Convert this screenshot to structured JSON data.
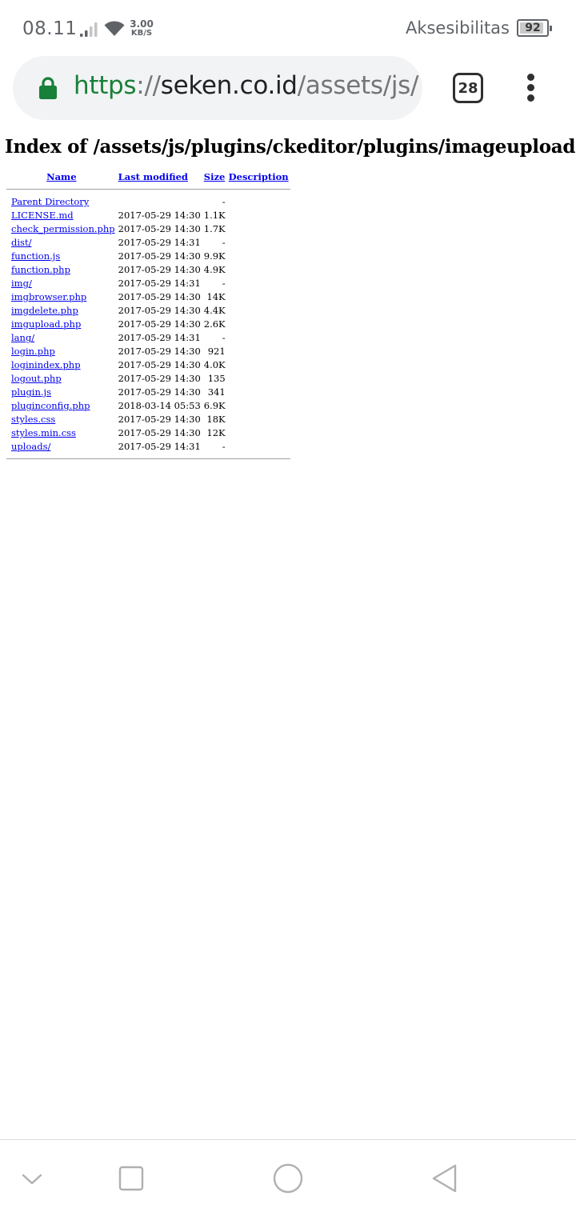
{
  "status_bar": {
    "time": "08.11",
    "speed_value": "3.00",
    "speed_unit": "KB/S",
    "accessibility_label": "Aksesibilitas",
    "battery_level": "92",
    "battery_fraction": 0.92
  },
  "browser": {
    "url": {
      "scheme": "https",
      "separator": "://",
      "host": "seken.co.id",
      "path": "/assets/js/"
    },
    "tab_count": "28",
    "colors": {
      "secure_scheme": "#188038",
      "lock": "#188038",
      "omnibox": "#f1f3f4",
      "link": "#0000ee"
    },
    "icons": {
      "lock": "lock-icon",
      "menu": "more-vert-icon"
    }
  },
  "page": {
    "title": "Index of /assets/js/plugins/ckeditor/plugins/imageuploader",
    "columns": {
      "name": "Name",
      "last_modified": "Last modified",
      "size": "Size",
      "description": "Description"
    },
    "entries": [
      {
        "name": "Parent Directory",
        "modified": "",
        "size": "-"
      },
      {
        "name": "LICENSE.md",
        "modified": "2017-05-29 14:30",
        "size": "1.1K"
      },
      {
        "name": "check_permission.php",
        "modified": "2017-05-29 14:30",
        "size": "1.7K"
      },
      {
        "name": "dist/",
        "modified": "2017-05-29 14:31",
        "size": "-"
      },
      {
        "name": "function.js",
        "modified": "2017-05-29 14:30",
        "size": "9.9K"
      },
      {
        "name": "function.php",
        "modified": "2017-05-29 14:30",
        "size": "4.9K"
      },
      {
        "name": "img/",
        "modified": "2017-05-29 14:31",
        "size": "-"
      },
      {
        "name": "imgbrowser.php",
        "modified": "2017-05-29 14:30",
        "size": "14K"
      },
      {
        "name": "imgdelete.php",
        "modified": "2017-05-29 14:30",
        "size": "4.4K"
      },
      {
        "name": "imgupload.php",
        "modified": "2017-05-29 14:30",
        "size": "2.6K"
      },
      {
        "name": "lang/",
        "modified": "2017-05-29 14:31",
        "size": "-"
      },
      {
        "name": "login.php",
        "modified": "2017-05-29 14:30",
        "size": "921"
      },
      {
        "name": "loginindex.php",
        "modified": "2017-05-29 14:30",
        "size": "4.0K"
      },
      {
        "name": "logout.php",
        "modified": "2017-05-29 14:30",
        "size": "135"
      },
      {
        "name": "plugin.js",
        "modified": "2017-05-29 14:30",
        "size": "341"
      },
      {
        "name": "pluginconfig.php",
        "modified": "2018-03-14 05:53",
        "size": "6.9K"
      },
      {
        "name": "styles.css",
        "modified": "2017-05-29 14:30",
        "size": "18K"
      },
      {
        "name": "styles.min.css",
        "modified": "2017-05-29 14:30",
        "size": "12K"
      },
      {
        "name": "uploads/",
        "modified": "2017-05-29 14:31",
        "size": "-"
      }
    ]
  },
  "nav_bar": {
    "icons": [
      "chevron-down-icon",
      "recents-square-icon",
      "home-circle-icon",
      "back-triangle-icon"
    ]
  }
}
